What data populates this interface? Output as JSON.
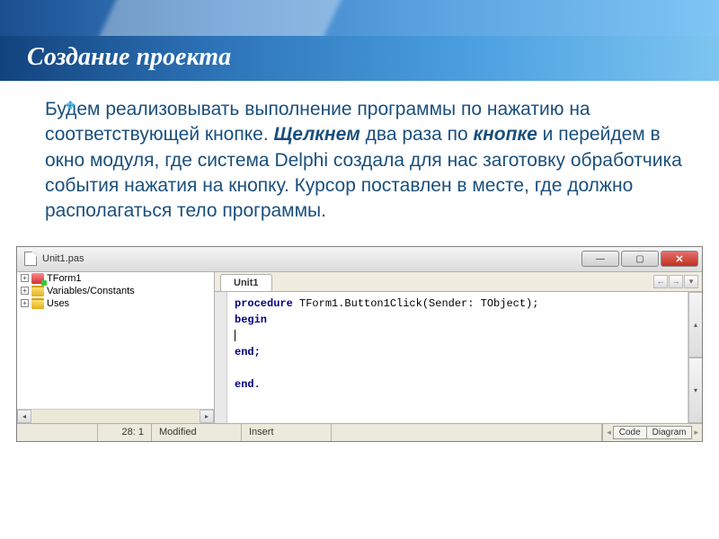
{
  "slide": {
    "title": "Создание проекта",
    "bullet_icon": "❖",
    "paragraph": {
      "part1": "Будем реализовывать выполнение программы по нажатию  на соответствующей кнопке. ",
      "emph1": "Щелкнем",
      "part2": " два раза по ",
      "emph2": "кнопке",
      "part3": " и перейдем в окно модуля, где система Delphi создала для нас заготовку обработчика события нажатия на кнопку. Курсор поставлен в месте, где должно располагаться тело программы."
    }
  },
  "window": {
    "title": "Unit1.pas",
    "buttons": {
      "min": "—",
      "max": "▢",
      "close": "✕"
    },
    "tree": {
      "items": [
        {
          "label": "TForm1",
          "icon": "tform"
        },
        {
          "label": "Variables/Constants",
          "icon": "folder"
        },
        {
          "label": "Uses",
          "icon": "folder"
        }
      ]
    },
    "editor": {
      "tab": "Unit1",
      "code": {
        "line1_kw": "procedure",
        "line1_rest": " TForm1.Button1Click(Sender: TObject);",
        "line2": "begin",
        "line4": "end;",
        "line6": "end."
      }
    },
    "status": {
      "pos": "28: 1",
      "state": "Modified",
      "mode": "Insert",
      "tab_code": "Code",
      "tab_diagram": "Diagram"
    }
  }
}
